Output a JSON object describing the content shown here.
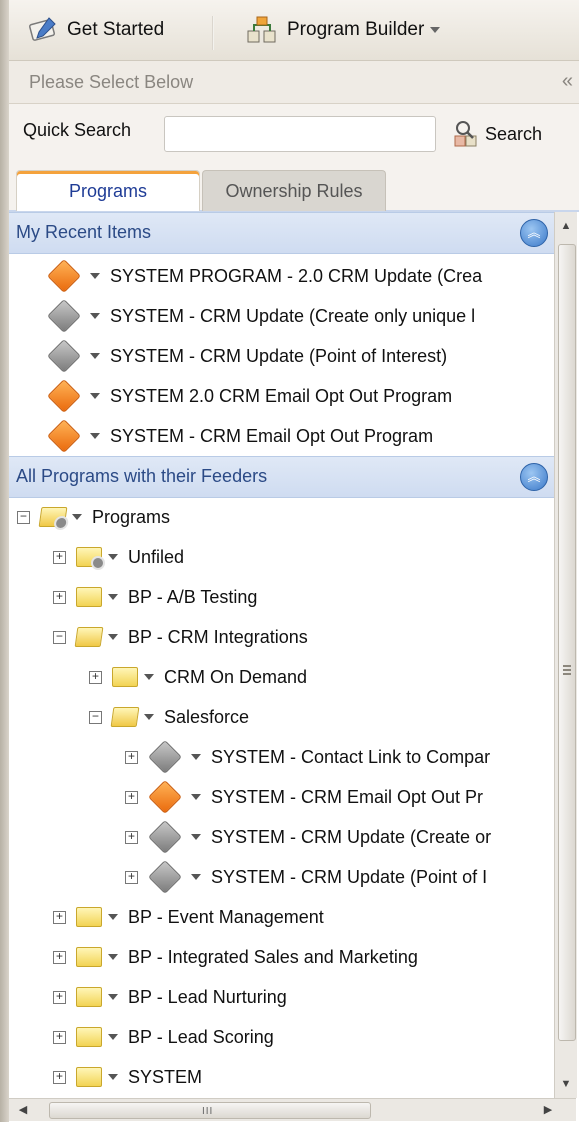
{
  "toolbar": {
    "get_started_label": "Get Started",
    "program_builder_label": "Program Builder"
  },
  "select_header": {
    "title": "Please Select Below",
    "collapse_glyph": "«"
  },
  "search": {
    "label": "Quick Search",
    "placeholder": "",
    "value": "",
    "button_label": "Search"
  },
  "tabs": [
    {
      "label": "Programs",
      "active": true
    },
    {
      "label": "Ownership Rules",
      "active": false
    }
  ],
  "recent": {
    "title": "My Recent Items",
    "items": [
      {
        "label": "SYSTEM PROGRAM - 2.0 CRM Update (Crea",
        "color": "orange"
      },
      {
        "label": "SYSTEM - CRM Update (Create only unique l",
        "color": "gray"
      },
      {
        "label": "SYSTEM - CRM Update (Point of Interest)",
        "color": "gray"
      },
      {
        "label": "SYSTEM 2.0 CRM Email Opt Out Program",
        "color": "orange"
      },
      {
        "label": "SYSTEM - CRM Email Opt Out Program",
        "color": "orange"
      }
    ]
  },
  "all_programs": {
    "title": "All Programs with their Feeders",
    "tree": [
      {
        "label": "Programs",
        "level": 0,
        "expander": "−",
        "icon": "folder-gear",
        "open": true
      },
      {
        "label": "Unfiled",
        "level": 1,
        "expander": "+",
        "icon": "folder-gear",
        "open": false
      },
      {
        "label": "BP - A/B Testing",
        "level": 1,
        "expander": "+",
        "icon": "folder",
        "open": false
      },
      {
        "label": "BP - CRM Integrations",
        "level": 1,
        "expander": "−",
        "icon": "folder",
        "open": true
      },
      {
        "label": "CRM On Demand",
        "level": 2,
        "expander": "+",
        "icon": "folder",
        "open": false
      },
      {
        "label": "Salesforce",
        "level": 2,
        "expander": "−",
        "icon": "folder",
        "open": true
      },
      {
        "label": "SYSTEM - Contact Link to Compar",
        "level": 3,
        "expander": "+",
        "icon": "diamond-gray"
      },
      {
        "label": "SYSTEM - CRM Email Opt Out Pr",
        "level": 3,
        "expander": "+",
        "icon": "diamond-orange"
      },
      {
        "label": "SYSTEM - CRM Update (Create or",
        "level": 3,
        "expander": "+",
        "icon": "diamond-gray"
      },
      {
        "label": "SYSTEM - CRM Update (Point of I",
        "level": 3,
        "expander": "+",
        "icon": "diamond-gray"
      },
      {
        "label": "BP - Event Management",
        "level": 1,
        "expander": "+",
        "icon": "folder",
        "open": false
      },
      {
        "label": "BP - Integrated Sales and Marketing",
        "level": 1,
        "expander": "+",
        "icon": "folder",
        "open": false
      },
      {
        "label": "BP - Lead Nurturing",
        "level": 1,
        "expander": "+",
        "icon": "folder",
        "open": false
      },
      {
        "label": "BP - Lead Scoring",
        "level": 1,
        "expander": "+",
        "icon": "folder",
        "open": false
      },
      {
        "label": "SYSTEM",
        "level": 1,
        "expander": "+",
        "icon": "folder",
        "open": false
      }
    ]
  },
  "scrollbar": {
    "horizontal_grip": "III",
    "vertical_grip": "≡"
  },
  "colors": {
    "accent_orange": "#ea6a0c",
    "section_header": "#cfdcf1",
    "tab_active_text": "#1f3c96"
  }
}
